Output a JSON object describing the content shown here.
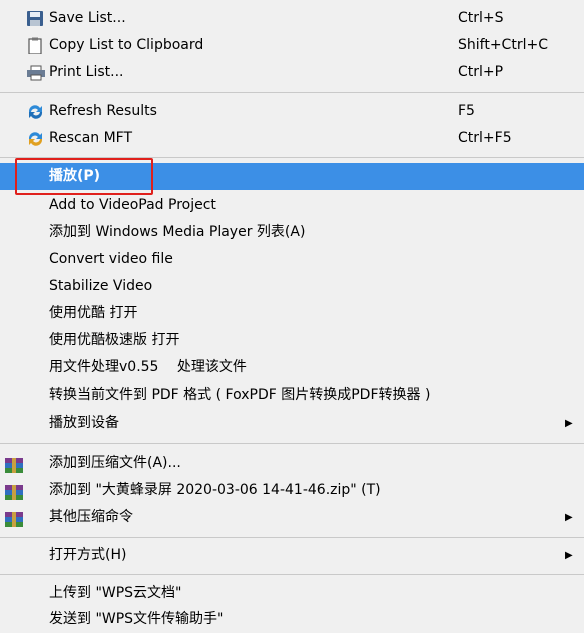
{
  "menu": {
    "items": [
      {
        "label": "Save List...",
        "shortcut": "Ctrl+S",
        "icon": "save-icon"
      },
      {
        "label": "Copy List to Clipboard",
        "shortcut": "Shift+Ctrl+C",
        "icon": "clipboard-icon"
      },
      {
        "label": "Print List...",
        "shortcut": "Ctrl+P",
        "icon": "printer-icon"
      },
      {
        "label": "Refresh Results",
        "shortcut": "F5",
        "icon": "refresh-icon"
      },
      {
        "label": "Rescan MFT",
        "shortcut": "Ctrl+F5",
        "icon": "rescan-icon"
      },
      {
        "label": "播放(P)",
        "shortcut": "",
        "icon": ""
      },
      {
        "label": "Add to VideoPad Project"
      },
      {
        "label": "添加到 Windows Media Player 列表(A)"
      },
      {
        "label": "Convert video file"
      },
      {
        "label": "Stabilize Video"
      },
      {
        "label": "使用优酷 打开"
      },
      {
        "label": "使用优酷极速版 打开"
      },
      {
        "label": "用文件处理v0.55　 处理该文件"
      },
      {
        "label": "转换当前文件到 PDF 格式 ( FoxPDF 图片转换成PDF转换器 )"
      },
      {
        "label": "播放到设备",
        "submenu_arrow": "▶"
      },
      {
        "label": "添加到压缩文件(A)...",
        "icon": "winrar-icon"
      },
      {
        "label": "添加到 \"大黄蜂录屏 2020-03-06 14-41-46.zip\" (T)",
        "icon": "winrar-icon"
      },
      {
        "label": "其他压缩命令",
        "icon": "winrar-icon",
        "submenu_arrow": "▶"
      },
      {
        "label": "打开方式(H)",
        "submenu_arrow": "▶"
      },
      {
        "label": "上传到 \"WPS云文档\""
      },
      {
        "label": "发送到 \"WPS文件传输助手\""
      }
    ]
  },
  "colors": {
    "selection": "#3c8fe6",
    "highlight_border": "#e0201c",
    "background": "#f0f0f0"
  }
}
